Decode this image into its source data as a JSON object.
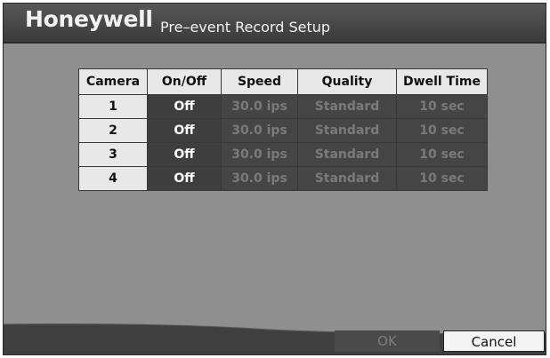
{
  "header": {
    "brand": "Honeywell",
    "title": "Pre–event Record Setup"
  },
  "table": {
    "columns": [
      "Camera",
      "On/Off",
      "Speed",
      "Quality",
      "Dwell Time"
    ],
    "rows": [
      {
        "camera": "1",
        "onoff": "Off",
        "speed": "30.0 ips",
        "quality": "Standard",
        "dwell": "10 sec"
      },
      {
        "camera": "2",
        "onoff": "Off",
        "speed": "30.0 ips",
        "quality": "Standard",
        "dwell": "10 sec"
      },
      {
        "camera": "3",
        "onoff": "Off",
        "speed": "30.0 ips",
        "quality": "Standard",
        "dwell": "10 sec"
      },
      {
        "camera": "4",
        "onoff": "Off",
        "speed": "30.0 ips",
        "quality": "Standard",
        "dwell": "10 sec"
      }
    ]
  },
  "buttons": {
    "ok": "OK",
    "cancel": "Cancel"
  },
  "colors": {
    "background": "#8f8f8f",
    "header": "#474747",
    "disabled_text": "#7a7a7a"
  }
}
